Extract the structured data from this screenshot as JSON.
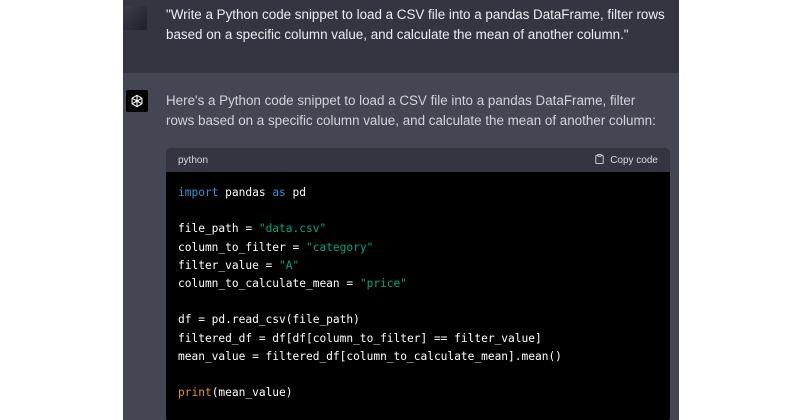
{
  "user_message": {
    "text": "\"Write a Python code snippet to load a CSV file into a pandas DataFrame, filter rows based on a specific column value, and calculate the mean of another column.\""
  },
  "assistant_message": {
    "intro": "Here's a Python code snippet to load a CSV file into a pandas DataFrame, filter rows based on a specific column value, and calculate the mean of another column:",
    "code_block": {
      "language": "python",
      "copy_label": "Copy code",
      "code": {
        "l1": {
          "import": "import",
          "module": " pandas ",
          "as": "as",
          "alias": " pd"
        },
        "l2": {
          "var": "file_path = ",
          "val": "\"data.csv\""
        },
        "l3": {
          "var": "column_to_filter = ",
          "val": "\"category\""
        },
        "l4": {
          "var": "filter_value = ",
          "val": "\"A\""
        },
        "l5": {
          "var": "column_to_calculate_mean = ",
          "val": "\"price\""
        },
        "l6": "df = pd.read_csv(file_path)",
        "l7": "filtered_df = df[df[column_to_filter] == filter_value]",
        "l8": "mean_value = filtered_df[column_to_calculate_mean].mean()",
        "l9": {
          "fn": "print",
          "args": "(mean_value)"
        }
      }
    }
  },
  "colors": {
    "chat_bg": "#343541",
    "assistant_bg": "#444654",
    "code_bg": "#000000",
    "keyword": "#2e95d3",
    "string": "#00a67d",
    "builtin": "#e9950c"
  },
  "icons": {
    "assistant_avatar": "openai-logo-icon",
    "copy": "clipboard-icon"
  }
}
